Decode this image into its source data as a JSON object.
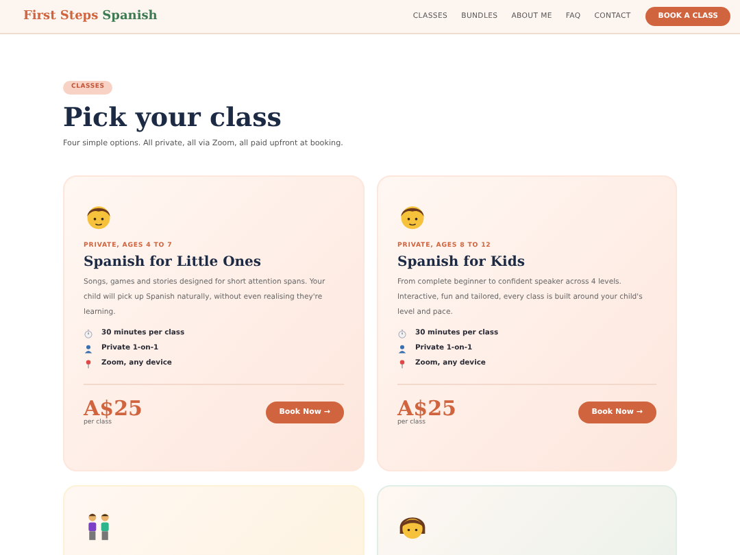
{
  "header": {
    "logo_first": "First Steps",
    "logo_second": "Spanish",
    "nav": [
      {
        "label": "CLASSES"
      },
      {
        "label": "BUNDLES"
      },
      {
        "label": "ABOUT ME"
      },
      {
        "label": "FAQ"
      },
      {
        "label": "CONTACT"
      }
    ],
    "cta": "BOOK A CLASS"
  },
  "intro": {
    "badge": "CLASSES",
    "title": "Pick your class",
    "subtitle": "Four simple options. All private, all via Zoom, all paid upfront at booking."
  },
  "cards": [
    {
      "kind": "child",
      "color": "#fde6dc",
      "tag": "PRIVATE, AGES 4 TO 7",
      "title": "Spanish for Little Ones",
      "description": "Songs, games and stories designed for short attention spans. Your child will pick up Spanish naturally, without even realising they're learning.",
      "features": [
        {
          "kind": "time",
          "text": "30 minutes per class"
        },
        {
          "kind": "person",
          "text": "Private 1-on-1"
        },
        {
          "kind": "pin",
          "text": "Zoom, any device"
        }
      ],
      "price": "A$25",
      "price_note": "per class",
      "button": "Book Now →"
    },
    {
      "kind": "child",
      "color": "#fde6dc",
      "tag": "PRIVATE, AGES 8 TO 12",
      "title": "Spanish for Kids",
      "description": "From complete beginner to confident speaker across 4 levels. Interactive, fun and tailored, every class is built around your child's level and pace.",
      "features": [
        {
          "kind": "time",
          "text": "30 minutes per class"
        },
        {
          "kind": "person",
          "text": "Private 1-on-1"
        },
        {
          "kind": "pin",
          "text": "Zoom, any device"
        }
      ],
      "price": "A$25",
      "price_note": "per class",
      "button": "Book Now →"
    },
    {
      "kind": "pair",
      "color": "#fdf1d6"
    },
    {
      "kind": "adult",
      "color": "#e0efe6"
    }
  ]
}
